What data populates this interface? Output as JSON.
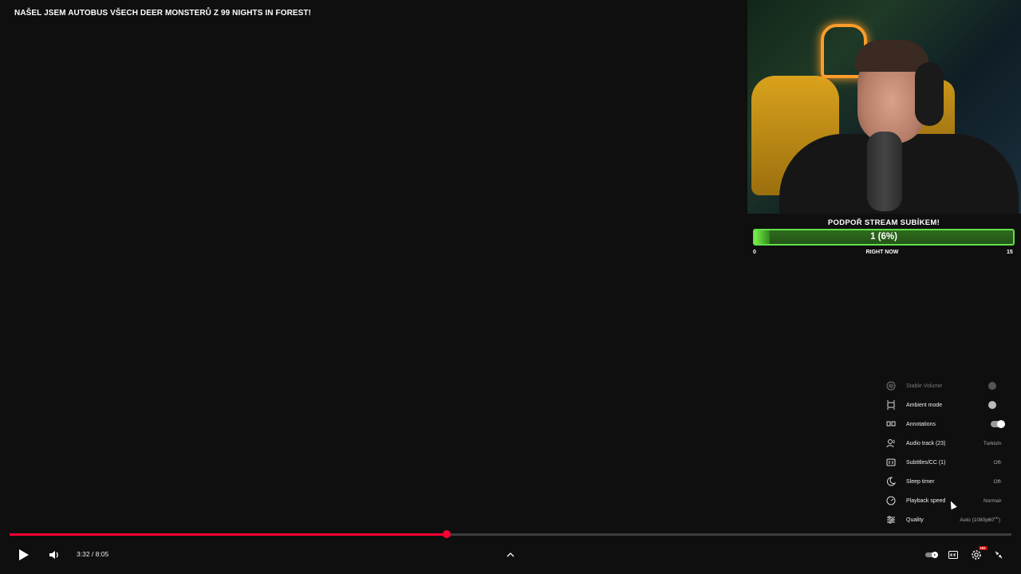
{
  "video": {
    "title": "NAŠEL JSEM AUTOBUS VŠECH DEER MONSTERŮ Z 99 NIGHTS IN FOREST!"
  },
  "sub_goal": {
    "title": "PODPOŘ STREAM SUBÍKEM!",
    "progress_text": "1 (6%)",
    "progress_fraction": 0.06,
    "min": "0",
    "label": "RIGHT NOW",
    "max": "15",
    "accent_color": "#63e04a"
  },
  "settings_menu": {
    "items": [
      {
        "label": "Stable Volume",
        "icon": "stable-volume-icon",
        "toggle": "disabled"
      },
      {
        "label": "Ambient mode",
        "icon": "ambient-mode-icon",
        "toggle": "off"
      },
      {
        "label": "Annotations",
        "icon": "annotations-icon",
        "toggle": "on"
      },
      {
        "label": "Audio track (23)",
        "icon": "audio-track-icon",
        "value": "Turkish"
      },
      {
        "label": "Subtitles/CC (1)",
        "icon": "subtitles-icon",
        "value": "Off"
      },
      {
        "label": "Sleep timer",
        "icon": "sleep-timer-icon",
        "value": "Off"
      },
      {
        "label": "Playback speed",
        "icon": "playback-speed-icon",
        "value": "Normal"
      },
      {
        "label": "Quality",
        "icon": "quality-icon",
        "value": "Auto (1080p60",
        "badge": "HD"
      }
    ]
  },
  "player": {
    "current_time": "3:32",
    "duration": "8:05",
    "time_display": "3:32 / 8:05",
    "played_fraction": 0.436,
    "accent_color": "#ff0033",
    "hd_badge": "HD"
  }
}
